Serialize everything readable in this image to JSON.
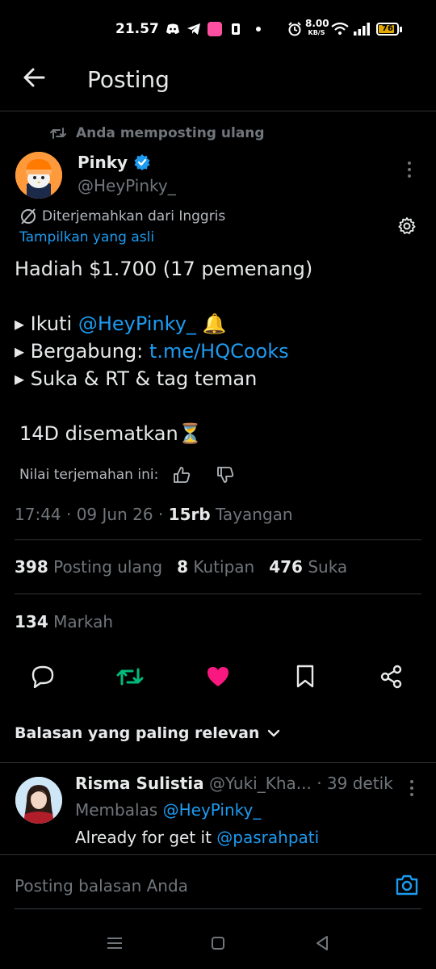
{
  "status_bar": {
    "time": "21.57",
    "network_speed": "8.00",
    "network_unit": "KB/S",
    "battery": "76"
  },
  "header": {
    "title": "Posting"
  },
  "repost_notice": "Anda memposting ulang",
  "tweet": {
    "author_name": "Pinky",
    "author_handle": "@HeyPinky_",
    "translated_label": "Diterjemahkan dari Inggris",
    "show_original": "Tampilkan yang asli",
    "line1": "Hadiah $1.700 (17 pemenang)",
    "follow_prefix": "▸ Ikuti ",
    "follow_handle": "@HeyPinky_",
    "follow_emoji": "🔔",
    "join_prefix": "▸ Bergabung: ",
    "join_link": "t.me/HQCooks",
    "like_line": "▸ Suka & RT & tag teman",
    "pinned_line": "14D disematkan⏳",
    "rate_label": "Nilai terjemahan ini:",
    "time_date": "17:44 · 09 Jun 26 · ",
    "views_count": "15rb",
    "views_label": " Tayangan"
  },
  "stats": {
    "reposts_count": "398",
    "reposts_label": "Posting ulang",
    "quotes_count": "8",
    "quotes_label": "Kutipan",
    "likes_count": "476",
    "likes_label": "Suka",
    "bookmarks_count": "134",
    "bookmarks_label": "Markah"
  },
  "colors": {
    "accent": "#1d9bf0",
    "repost_active": "#00ba7c",
    "like_active": "#f91880"
  },
  "replies_sort": "Balasan yang paling relevan",
  "reply": {
    "name": "Risma Sulistia",
    "handle": "@Yuki_Kha...",
    "time": "· 39 detik",
    "replying_label": "Membalas ",
    "replying_handle": "@HeyPinky_",
    "text": "Already for get it ",
    "mention": "@pasrahpati"
  },
  "compose": {
    "placeholder": "Posting balasan Anda"
  }
}
